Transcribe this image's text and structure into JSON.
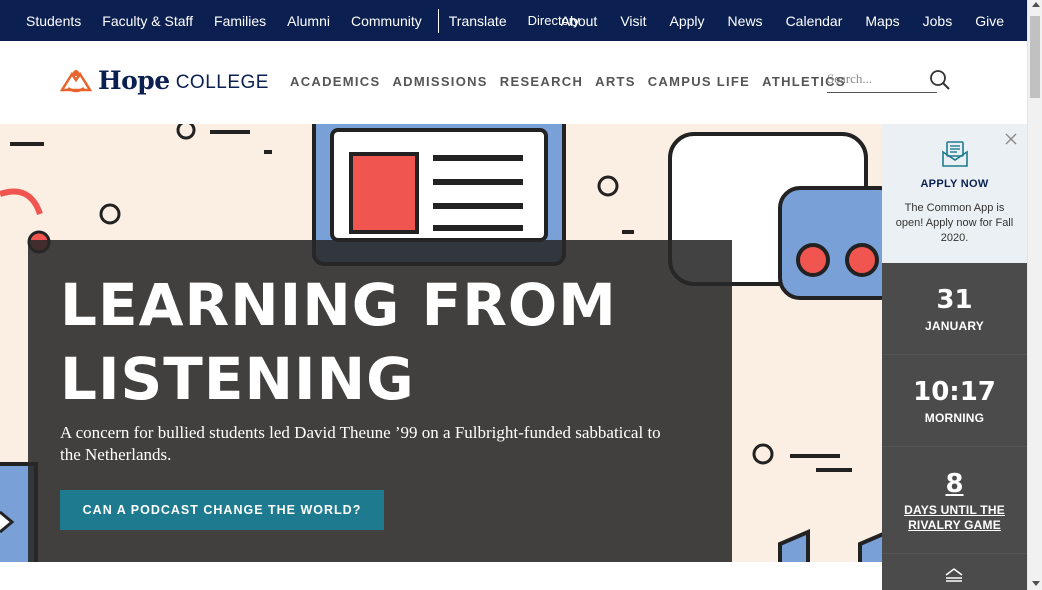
{
  "topbar": {
    "left_links": [
      "Students",
      "Faculty & Staff",
      "Families",
      "Alumni",
      "Community"
    ],
    "translate": "Translate",
    "directory": "Directory",
    "right_links": [
      "About",
      "Visit",
      "Apply",
      "News",
      "Calendar",
      "Maps",
      "Jobs",
      "Give"
    ]
  },
  "header": {
    "logo_hope": "Hope",
    "logo_college": "COLLEGE",
    "nav": [
      "ACADEMICS",
      "ADMISSIONS",
      "RESEARCH",
      "ARTS",
      "CAMPUS LIFE",
      "ATHLETICS"
    ],
    "search_placeholder": "Search..."
  },
  "hero": {
    "title": "LEARNING FROM LISTENING",
    "subtitle": "A concern for bullied students led David Theune ’99 on a Fulbright-funded sabbatical to the Netherlands.",
    "cta_label": "CAN A PODCAST CHANGE THE WORLD?"
  },
  "apply_panel": {
    "title": "APPLY NOW",
    "description": "The Common App is open! Apply now for Fall 2020."
  },
  "sidebar": {
    "date_number": "31",
    "date_label": "JANUARY",
    "time_number": "10:17",
    "time_label": "MORNING",
    "rivalry_number": "8",
    "rivalry_label": "DAYS UNTIL THE RIVALRY GAME"
  },
  "colors": {
    "navy": "#0b2050",
    "accent_orange": "#e8632b",
    "cta_teal": "#1e7b8f",
    "hero_bg": "#fbeee3"
  }
}
